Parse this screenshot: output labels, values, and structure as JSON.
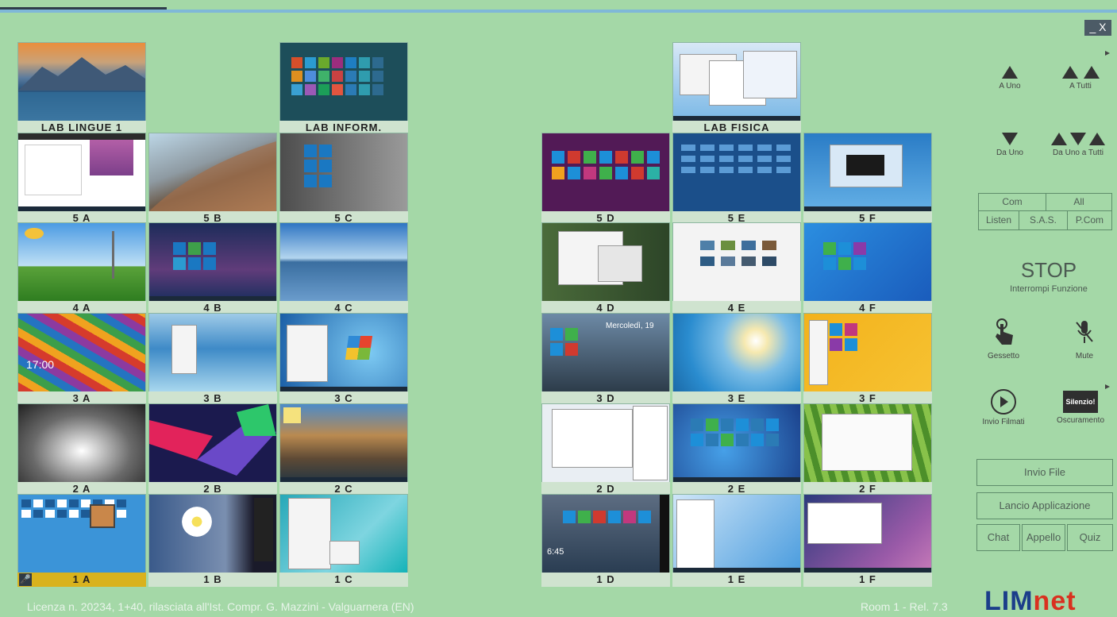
{
  "labs": [
    {
      "label": "LAB LINGUE 1"
    },
    {
      "label": "LAB INFORM."
    },
    {
      "label": "LAB FISICA"
    }
  ],
  "left_grid": [
    [
      "5 A",
      "5 B",
      "5 C"
    ],
    [
      "4 A",
      "4 B",
      "4 C"
    ],
    [
      "3 A",
      "3 B",
      "3 C"
    ],
    [
      "2 A",
      "2 B",
      "2 C"
    ],
    [
      "1 A",
      "1 B",
      "1 C"
    ]
  ],
  "right_grid": [
    [
      "5 D",
      "5 E",
      "5 F"
    ],
    [
      "4 D",
      "4 E",
      "4 F"
    ],
    [
      "3 D",
      "3 E",
      "3 F"
    ],
    [
      "2 D",
      "2 E",
      "2 F"
    ],
    [
      "1 D",
      "1 E",
      "1 F"
    ]
  ],
  "overlay_text": {
    "lock_time": "17:00",
    "desktop_date": "Mercoledì, 19",
    "small_time": "6:45"
  },
  "controls": {
    "a_uno": "A Uno",
    "a_tutti": "A Tutti",
    "da_uno": "Da Uno",
    "da_uno_a_tutti": "Da Uno a Tutti",
    "com": "Com",
    "all": "All",
    "listen": "Listen",
    "sas": "S.A.S.",
    "pcom": "P.Com",
    "stop_title": "STOP",
    "stop_sub": "Interrompi Funzione",
    "gessetto": "Gessetto",
    "mute": "Mute",
    "invio_filmati": "Invio Filmati",
    "silenzio": "Silenzio!",
    "oscuramento": "Oscuramento",
    "invio_file": "Invio File",
    "lancio_applicazione": "Lancio Applicazione",
    "chat": "Chat",
    "appello": "Appello",
    "quiz": "Quiz",
    "window_btn": "_ X"
  },
  "footer": {
    "license": "Licenza n. 20234, 1+40, rilasciata all'Ist. Compr. G. Mazzini - Valguarnera (EN)",
    "room": "Room 1 - Rel. 7.3",
    "logo_a": "LIM",
    "logo_b": "net"
  },
  "colors": {
    "background": "#a4d8a7",
    "label_bg": "#cfe3cf",
    "highlight": "#d9b21d",
    "logo_blue": "#1b3e8a",
    "logo_red": "#d9311f"
  }
}
